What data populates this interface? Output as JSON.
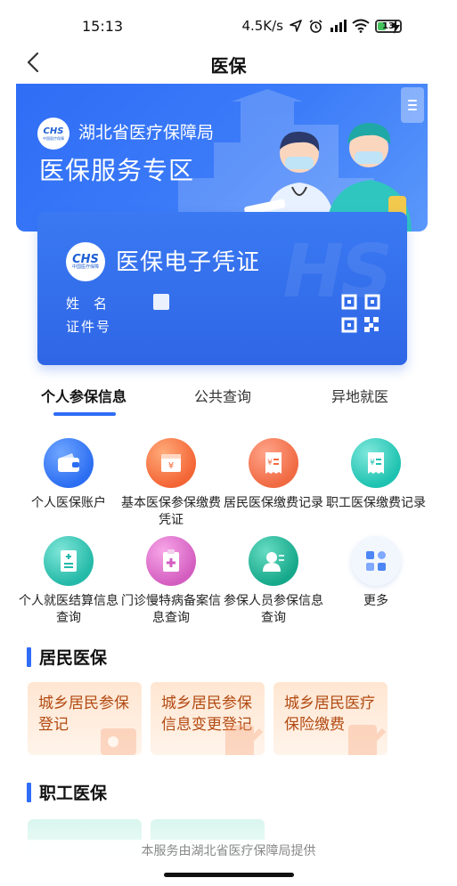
{
  "status_bar": {
    "time": "15:13",
    "net_speed": "4.5K/s",
    "battery": "13",
    "battery_color": "#43c35c"
  },
  "nav": {
    "title": "医保"
  },
  "banner": {
    "org": "湖北省医疗保障局",
    "title": "医保服务专区",
    "logo_text": "CHS",
    "logo_sub": "中国医疗保障"
  },
  "cert": {
    "title": "医保电子凭证",
    "name_label": "姓名",
    "id_label": "证件号",
    "watermark": "HS",
    "logo_text": "CHS",
    "logo_sub": "中国医疗保障"
  },
  "tabs": [
    {
      "label": "个人参保信息",
      "active": true
    },
    {
      "label": "公共查询",
      "active": false
    },
    {
      "label": "异地就医",
      "active": false
    }
  ],
  "services": [
    {
      "label": "个人医保账户",
      "icon": "wallet-icon"
    },
    {
      "label": "基本医保参保缴费凭证",
      "icon": "receipt-icon"
    },
    {
      "label": "居民医保缴费记录",
      "icon": "payment-record-icon"
    },
    {
      "label": "职工医保缴费记录",
      "icon": "payment-record-icon"
    },
    {
      "label": "个人就医结算信息查询",
      "icon": "settlement-doc-icon"
    },
    {
      "label": "门诊慢特病备案信息查询",
      "icon": "clipboard-cross-icon"
    },
    {
      "label": "参保人员参保信息查询",
      "icon": "person-info-icon"
    },
    {
      "label": "更多",
      "icon": "more-grid-icon"
    }
  ],
  "sections": {
    "resident": "居民医保",
    "worker": "职工医保"
  },
  "resident_cards": [
    {
      "label": "城乡居民参保登记"
    },
    {
      "label": "城乡居民参保信息变更登记"
    },
    {
      "label": "城乡居民医疗保险缴费"
    }
  ],
  "footer": {
    "note": "本服务由湖北省医疗保障局提供"
  },
  "colors": {
    "primary": "#2f6df6",
    "resident_card_text": "#b24a12",
    "resident_card_bg": "#ffe6d2"
  }
}
